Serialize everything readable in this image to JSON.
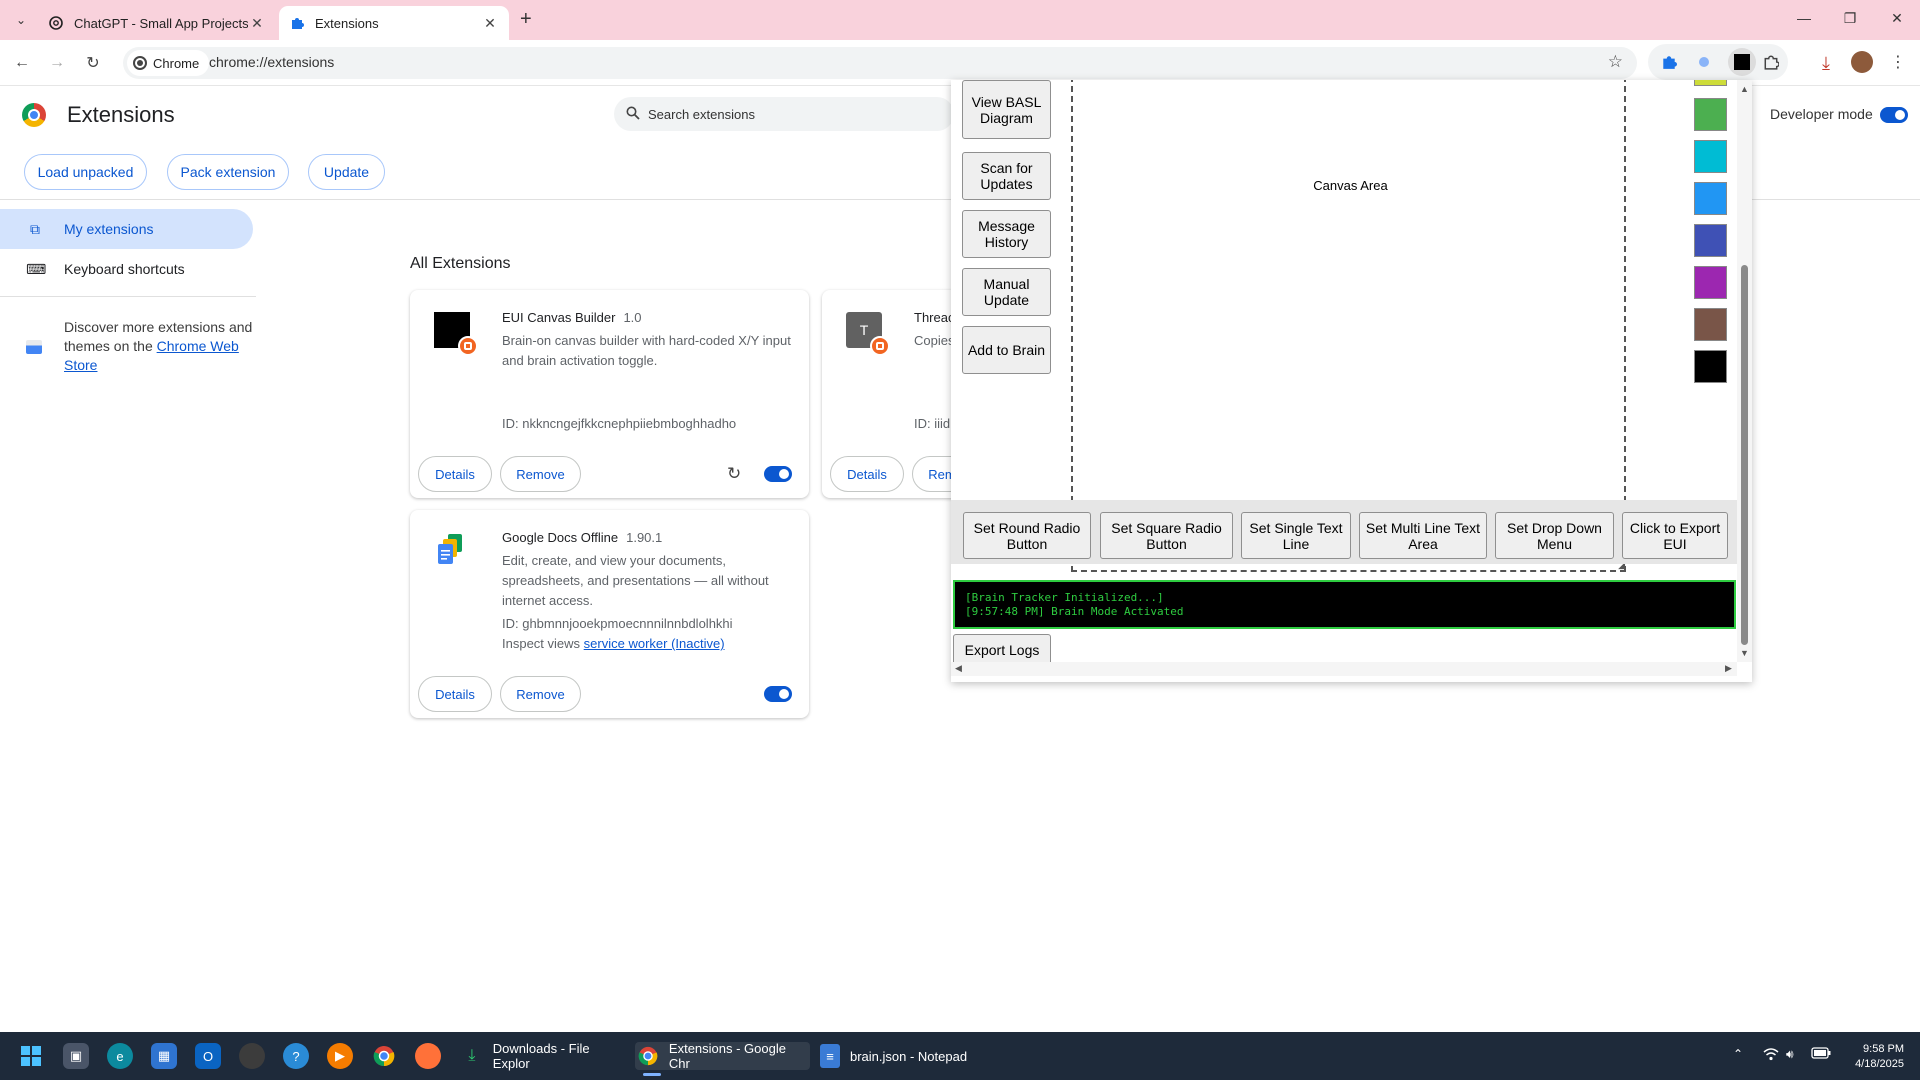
{
  "browser": {
    "tabs": [
      {
        "title": "ChatGPT - Small App Projects",
        "active": false
      },
      {
        "title": "Extensions",
        "active": true
      }
    ],
    "url": "chrome://extensions",
    "chip_label": "Chrome"
  },
  "header": {
    "title": "Extensions",
    "search_placeholder": "Search extensions",
    "developer_mode_label": "Developer mode",
    "developer_mode_on": true,
    "buttons": [
      "Load unpacked",
      "Pack extension",
      "Update"
    ]
  },
  "sidebar": {
    "items": [
      {
        "label": "My extensions",
        "selected": true
      },
      {
        "label": "Keyboard shortcuts",
        "selected": false
      }
    ],
    "discover_text": "Discover more extensions and themes on the",
    "store_link": "Chrome Web Store"
  },
  "main": {
    "section_title": "All Extensions",
    "cards": [
      {
        "name": "EUI Canvas Builder",
        "version": "1.0",
        "description": "Brain-on canvas builder with hard-coded X/Y input and brain activation toggle.",
        "id": "ID: nkkncngejfkkcnephpiiebmboghhadho",
        "details": "Details",
        "remove": "Remove",
        "enabled": true
      },
      {
        "name": "Threac",
        "description": "Copies",
        "id": "ID: iiid",
        "icon_letter": "T",
        "details": "Details",
        "remove": "Rem"
      },
      {
        "name": "Google Docs Offline",
        "version": "1.90.1",
        "description": "Edit, create, and view your documents, spreadsheets, and presentations — all without internet access.",
        "id": "ID: ghbmnnjooekpmoecnnnilnnbdlolhkhi",
        "inspect_label": "Inspect views",
        "inspect_link": "service worker (Inactive)",
        "details": "Details",
        "remove": "Remove",
        "enabled": true
      }
    ]
  },
  "popup": {
    "side_buttons": [
      "View BASL Diagram",
      "Scan for Updates",
      "Message History",
      "Manual Update",
      "Add to Brain"
    ],
    "canvas_label": "Canvas Area",
    "swatches": [
      "#cddc39",
      "#4caf50",
      "#00bcd4",
      "#2196f3",
      "#3f51b5",
      "#9c27b0",
      "#795548",
      "#000000"
    ],
    "row_buttons": [
      "Set Round Radio Button",
      "Set Square Radio Button",
      "Set Single Text Line",
      "Set Multi Line Text Area",
      "Set Drop Down Menu",
      "Click to Export EUI"
    ],
    "log_lines": [
      "[Brain Tracker Initialized...]",
      "[9:57:48 PM] Brain Mode Activated"
    ],
    "export_logs": "Export Logs"
  },
  "taskbar": {
    "apps": [
      {
        "label": "Downloads - File Explor"
      },
      {
        "label": "Extensions - Google Chr",
        "active": true
      },
      {
        "label": "brain.json - Notepad"
      }
    ],
    "time": "9:58 PM",
    "date": "4/18/2025"
  },
  "colors": {
    "accent": "#0b57d0",
    "tabbar": "#f9d2dc",
    "log_green": "#2ecc40",
    "taskbar": "#1e2a3a"
  }
}
